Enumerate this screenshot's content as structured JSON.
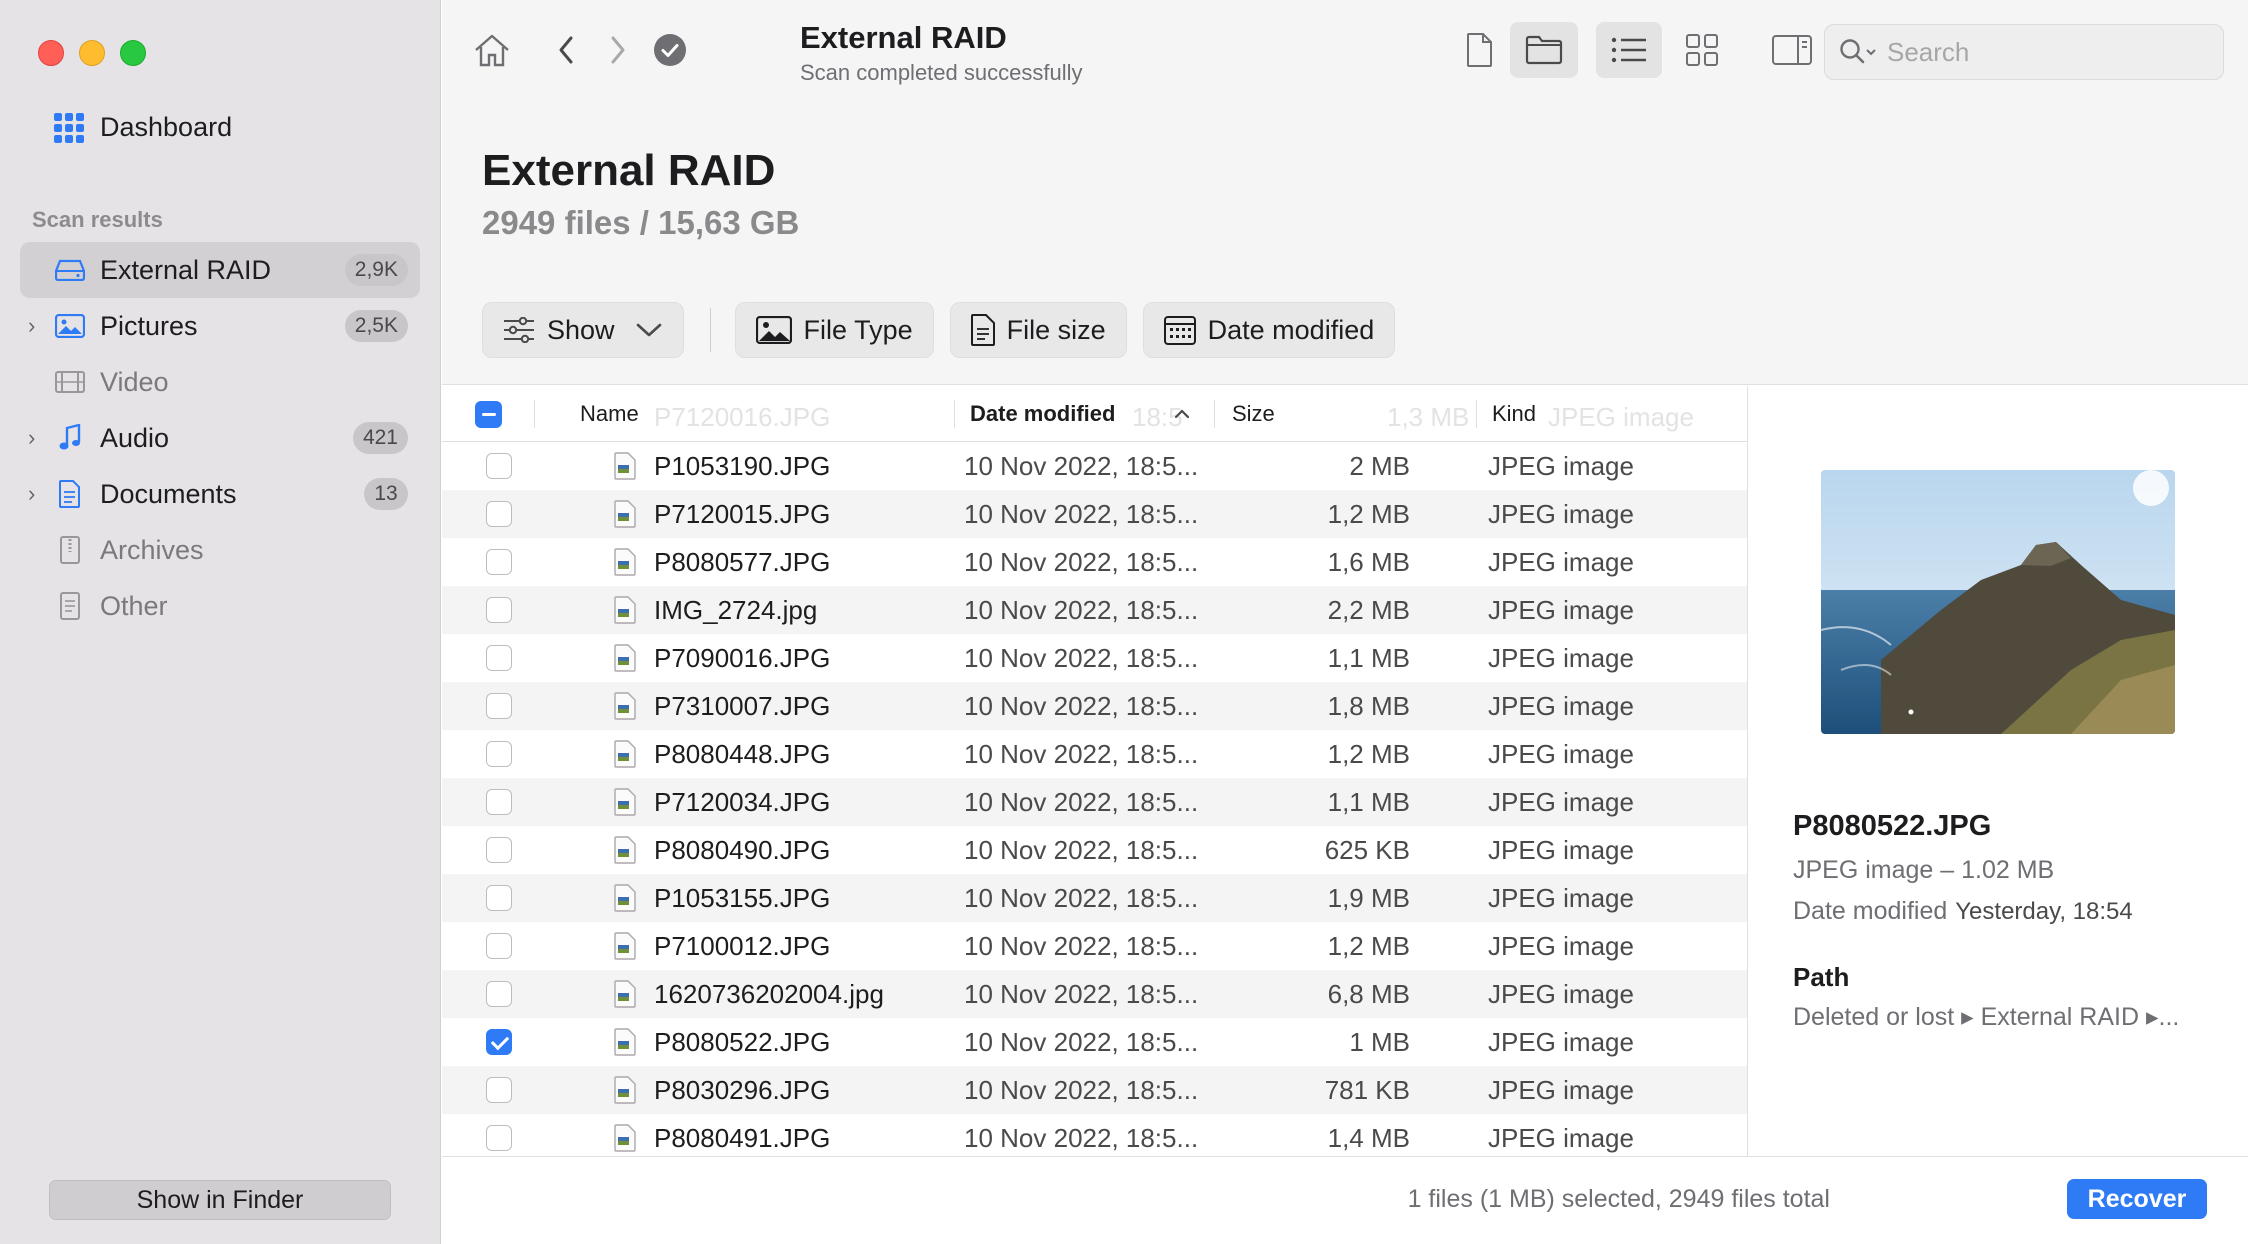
{
  "sidebar": {
    "dashboard_label": "Dashboard",
    "section_label": "Scan results",
    "items": [
      {
        "label": "External RAID",
        "badge": "2,9K",
        "icon": "drive-icon"
      },
      {
        "label": "Pictures",
        "badge": "2,5K",
        "icon": "image-icon"
      },
      {
        "label": "Video",
        "badge": "",
        "icon": "film-icon"
      },
      {
        "label": "Audio",
        "badge": "421",
        "icon": "music-note-icon"
      },
      {
        "label": "Documents",
        "badge": "13",
        "icon": "document-icon"
      },
      {
        "label": "Archives",
        "badge": "",
        "icon": "archive-icon"
      },
      {
        "label": "Other",
        "badge": "",
        "icon": "other-file-icon"
      }
    ],
    "show_in_finder_label": "Show in Finder"
  },
  "toolbar": {
    "title": "External RAID",
    "subtitle": "Scan completed successfully",
    "search_placeholder": "Search"
  },
  "header": {
    "title": "External RAID",
    "summary": "2949 files / 15,63 GB",
    "filters": {
      "show": "Show",
      "file_type": "File Type",
      "file_size": "File size",
      "date_modified": "Date modified"
    }
  },
  "table": {
    "columns": {
      "name": "Name",
      "date": "Date modified",
      "size": "Size",
      "kind": "Kind"
    },
    "ghost_row": {
      "name": "P7120016.JPG",
      "date": "18:5",
      "size": "1,3 MB",
      "kind": "JPEG image"
    },
    "rows": [
      {
        "name": "P1053190.JPG",
        "date": "10 Nov 2022, 18:5...",
        "size": "2 MB",
        "kind": "JPEG image",
        "checked": false
      },
      {
        "name": "P7120015.JPG",
        "date": "10 Nov 2022, 18:5...",
        "size": "1,2 MB",
        "kind": "JPEG image",
        "checked": false
      },
      {
        "name": "P8080577.JPG",
        "date": "10 Nov 2022, 18:5...",
        "size": "1,6 MB",
        "kind": "JPEG image",
        "checked": false
      },
      {
        "name": "IMG_2724.jpg",
        "date": "10 Nov 2022, 18:5...",
        "size": "2,2 MB",
        "kind": "JPEG image",
        "checked": false
      },
      {
        "name": "P7090016.JPG",
        "date": "10 Nov 2022, 18:5...",
        "size": "1,1 MB",
        "kind": "JPEG image",
        "checked": false
      },
      {
        "name": "P7310007.JPG",
        "date": "10 Nov 2022, 18:5...",
        "size": "1,8 MB",
        "kind": "JPEG image",
        "checked": false
      },
      {
        "name": "P8080448.JPG",
        "date": "10 Nov 2022, 18:5...",
        "size": "1,2 MB",
        "kind": "JPEG image",
        "checked": false
      },
      {
        "name": "P7120034.JPG",
        "date": "10 Nov 2022, 18:5...",
        "size": "1,1 MB",
        "kind": "JPEG image",
        "checked": false
      },
      {
        "name": "P8080490.JPG",
        "date": "10 Nov 2022, 18:5...",
        "size": "625 KB",
        "kind": "JPEG image",
        "checked": false
      },
      {
        "name": "P1053155.JPG",
        "date": "10 Nov 2022, 18:5...",
        "size": "1,9 MB",
        "kind": "JPEG image",
        "checked": false
      },
      {
        "name": "P7100012.JPG",
        "date": "10 Nov 2022, 18:5...",
        "size": "1,2 MB",
        "kind": "JPEG image",
        "checked": false
      },
      {
        "name": "1620736202004.jpg",
        "date": "10 Nov 2022, 18:5...",
        "size": "6,8 MB",
        "kind": "JPEG image",
        "checked": false
      },
      {
        "name": "P8080522.JPG",
        "date": "10 Nov 2022, 18:5...",
        "size": "1 MB",
        "kind": "JPEG image",
        "checked": true
      },
      {
        "name": "P8030296.JPG",
        "date": "10 Nov 2022, 18:5...",
        "size": "781 KB",
        "kind": "JPEG image",
        "checked": false
      },
      {
        "name": "P8080491.JPG",
        "date": "10 Nov 2022, 18:5...",
        "size": "1,4 MB",
        "kind": "JPEG image",
        "checked": false
      }
    ]
  },
  "details": {
    "name": "P8080522.JPG",
    "kind_size": "JPEG image – 1.02 MB",
    "date_label": "Date modified",
    "date_value": "Yesterday, 18:54",
    "path_label": "Path",
    "path_value": "Deleted or lost ▸ External RAID ▸..."
  },
  "footer": {
    "status": "1 files (1 MB) selected, 2949 files total",
    "recover_label": "Recover"
  },
  "colors": {
    "accent": "#2f7bf6",
    "sidebar_bg": "#e6e3e6",
    "close": "#ff5f57",
    "minimize": "#febc2e",
    "zoom": "#28c840"
  }
}
